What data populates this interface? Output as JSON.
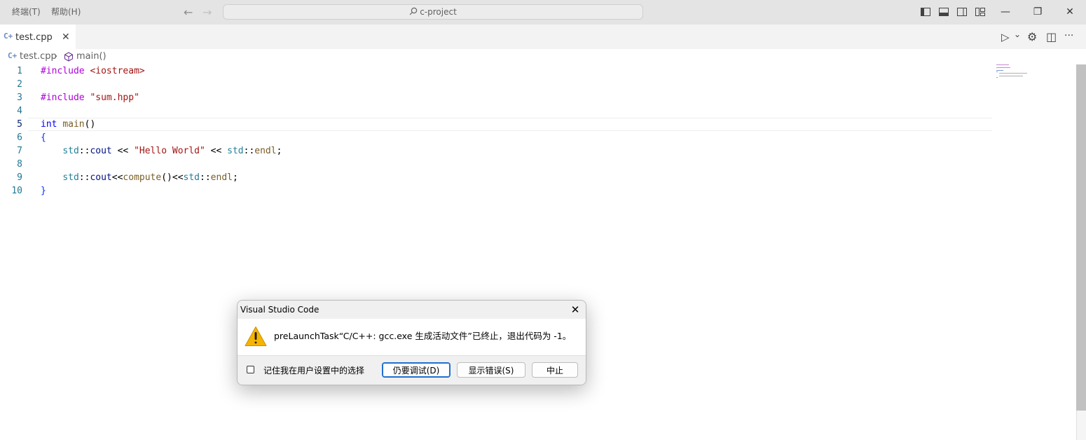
{
  "titlebar": {
    "menus": [
      "終端(T)",
      "帮助(H)"
    ],
    "search_text": "c-project",
    "back_arrow": "←",
    "forward_arrow": "→",
    "minimize": "—",
    "restore": "❐",
    "close": "✕"
  },
  "tab": {
    "icon_text": "C+",
    "label": "test.cpp",
    "close": "✕"
  },
  "tab_actions": {
    "run": "▷",
    "run_menu": "⌄",
    "settings": "⚙",
    "split": "◫",
    "more": "···"
  },
  "breadcrumb": {
    "file_icon_text": "C+",
    "file": "test.cpp",
    "separator": "›",
    "symbol": "main()"
  },
  "editor": {
    "line_numbers": [
      "1",
      "2",
      "3",
      "4",
      "5",
      "6",
      "7",
      "8",
      "9",
      "10"
    ],
    "active_line": 5,
    "lines": [
      [
        {
          "t": "#include",
          "c": "kw-pp"
        },
        {
          "t": " ",
          "c": ""
        },
        {
          "t": "<iostream>",
          "c": "str"
        }
      ],
      [],
      [
        {
          "t": "#include",
          "c": "kw-pp"
        },
        {
          "t": " ",
          "c": ""
        },
        {
          "t": "\"sum.hpp\"",
          "c": "str"
        }
      ],
      [],
      [
        {
          "t": "int",
          "c": "type"
        },
        {
          "t": " ",
          "c": ""
        },
        {
          "t": "main",
          "c": "fn"
        },
        {
          "t": "()",
          "c": "op"
        }
      ],
      [
        {
          "t": "{",
          "c": "brace"
        }
      ],
      [
        {
          "t": "    ",
          "c": ""
        },
        {
          "t": "std",
          "c": "ns"
        },
        {
          "t": "::",
          "c": "op"
        },
        {
          "t": "cout",
          "c": "id"
        },
        {
          "t": " << ",
          "c": "op"
        },
        {
          "t": "\"Hello World\"",
          "c": "str"
        },
        {
          "t": " << ",
          "c": "op"
        },
        {
          "t": "std",
          "c": "ns"
        },
        {
          "t": "::",
          "c": "op"
        },
        {
          "t": "endl",
          "c": "fn"
        },
        {
          "t": ";",
          "c": "op"
        }
      ],
      [],
      [
        {
          "t": "    ",
          "c": ""
        },
        {
          "t": "std",
          "c": "ns"
        },
        {
          "t": "::",
          "c": "op"
        },
        {
          "t": "cout",
          "c": "id"
        },
        {
          "t": "<<",
          "c": "op"
        },
        {
          "t": "compute",
          "c": "fn"
        },
        {
          "t": "()",
          "c": "op"
        },
        {
          "t": "<<",
          "c": "op"
        },
        {
          "t": "std",
          "c": "ns"
        },
        {
          "t": "::",
          "c": "op"
        },
        {
          "t": "endl",
          "c": "fn"
        },
        {
          "t": ";",
          "c": "op"
        }
      ],
      [
        {
          "t": "}",
          "c": "brace"
        }
      ]
    ]
  },
  "dialog": {
    "title": "Visual Studio Code",
    "close": "✕",
    "message": "preLaunchTask“C/C++: gcc.exe 生成活动文件”已终止，退出代码为 -1。",
    "remember_label": "记住我在用户设置中的选择",
    "buttons": {
      "debug_anyway": "仍要调试(D)",
      "show_errors": "显示错误(S)",
      "abort": "中止"
    }
  },
  "colors": {
    "accent": "#1f6fd1",
    "warning": "#f5b400",
    "titlebar_bg": "#e4e4e4"
  }
}
